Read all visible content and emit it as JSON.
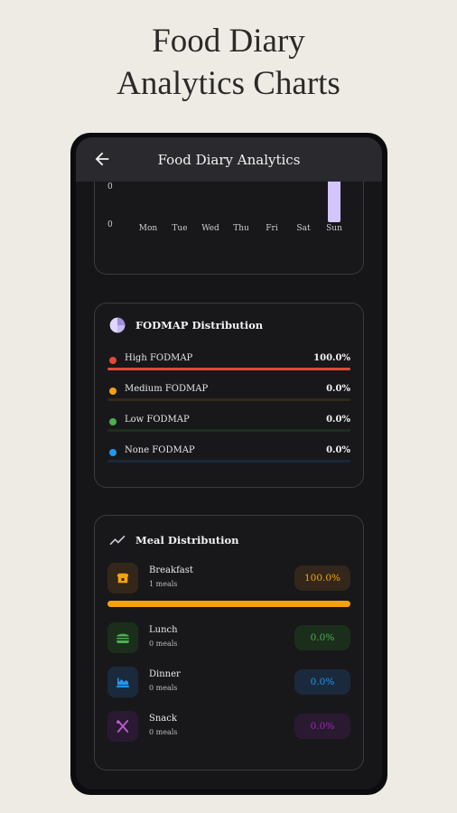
{
  "promo": {
    "line1": "Food Diary",
    "line2": "Analytics Charts"
  },
  "appbar": {
    "title": "Food Diary Analytics",
    "back_icon": "arrow-left-icon"
  },
  "weekly_chart": {
    "y_ticks": [
      "0",
      "0"
    ],
    "days": [
      "Mon",
      "Tue",
      "Wed",
      "Thu",
      "Fri",
      "Sat",
      "Sun"
    ],
    "bar_color": "#d4c5ff"
  },
  "chart_data": {
    "type": "bar",
    "categories": [
      "Mon",
      "Tue",
      "Wed",
      "Thu",
      "Fri",
      "Sat",
      "Sun"
    ],
    "values": [
      0,
      0,
      0,
      0,
      0,
      0,
      1
    ]
  },
  "fodmap": {
    "title": "FODMAP Distribution",
    "icon": "pie-chart-icon",
    "rows": [
      {
        "label": "High FODMAP",
        "value": "100.0%",
        "fraction": 1.0,
        "color": "#e5473a",
        "track": "#3a1e1c"
      },
      {
        "label": "Medium FODMAP",
        "value": "0.0%",
        "fraction": 0.0,
        "color": "#f5a20a",
        "track": "#33291a"
      },
      {
        "label": "Low FODMAP",
        "value": "0.0%",
        "fraction": 0.0,
        "color": "#4caf50",
        "track": "#1c2e1d"
      },
      {
        "label": "None FODMAP",
        "value": "0.0%",
        "fraction": 0.0,
        "color": "#2196f3",
        "track": "#1a2838"
      }
    ]
  },
  "meals": {
    "title": "Meal Distribution",
    "icon": "trending-up-icon",
    "rows": [
      {
        "name": "Breakfast",
        "count": "1 meals",
        "pct": "100.0%",
        "color": "#f5a20a",
        "bg": "#33261a",
        "icon": "toast-icon"
      },
      {
        "name": "Lunch",
        "count": "0 meals",
        "pct": "0.0%",
        "color": "#4caf50",
        "bg": "#1b2e1c",
        "icon": "burger-icon"
      },
      {
        "name": "Dinner",
        "count": "0 meals",
        "pct": "0.0%",
        "color": "#2196f3",
        "bg": "#1a2a3c",
        "icon": "dinner-icon"
      },
      {
        "name": "Snack",
        "count": "0 meals",
        "pct": "0.0%",
        "color": "#9c27b0",
        "bg": "#2a1a31",
        "icon": "fork-knife-icon"
      }
    ],
    "breakfast_fraction": 1.0
  }
}
